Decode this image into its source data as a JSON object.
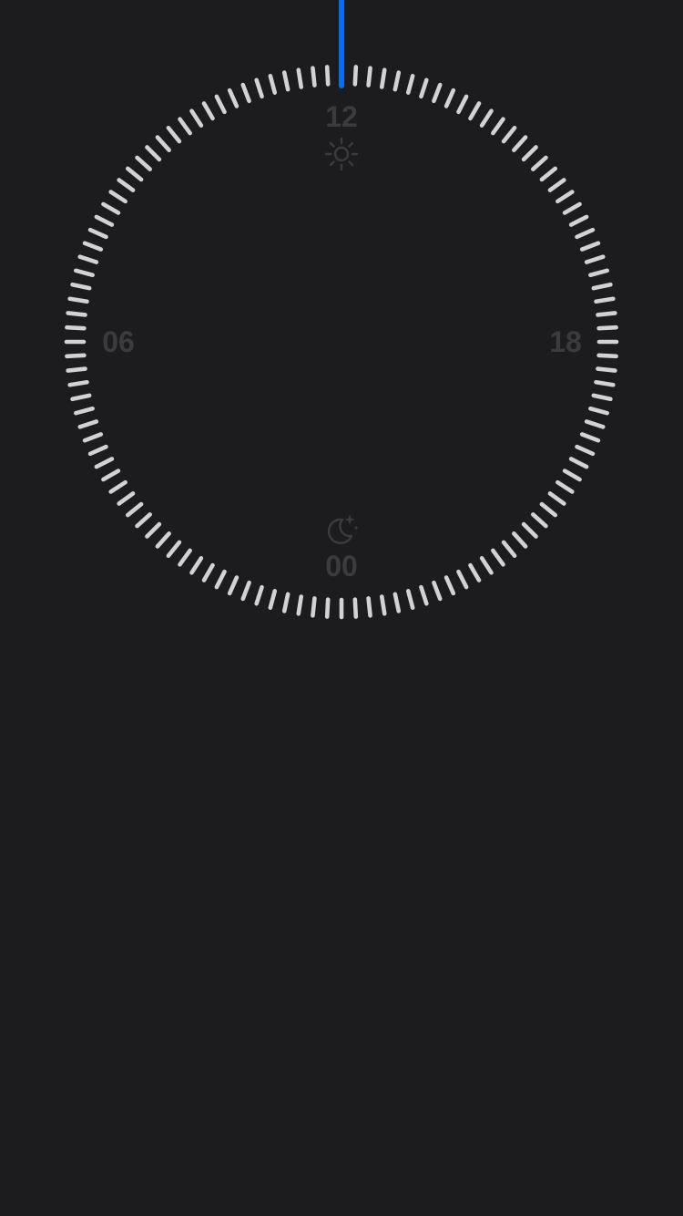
{
  "clock": {
    "hour_labels": {
      "top": "12",
      "left": "06",
      "right": "18",
      "bottom": "00"
    },
    "icons": {
      "top": "sun-icon",
      "bottom": "moon-stars-icon"
    },
    "tick_count": 120,
    "selected_hour": 12,
    "colors": {
      "background": "#1c1c1e",
      "tick": "#d1d1d6",
      "label": "#3b3b3d",
      "handle": "#0a6cf0"
    }
  }
}
